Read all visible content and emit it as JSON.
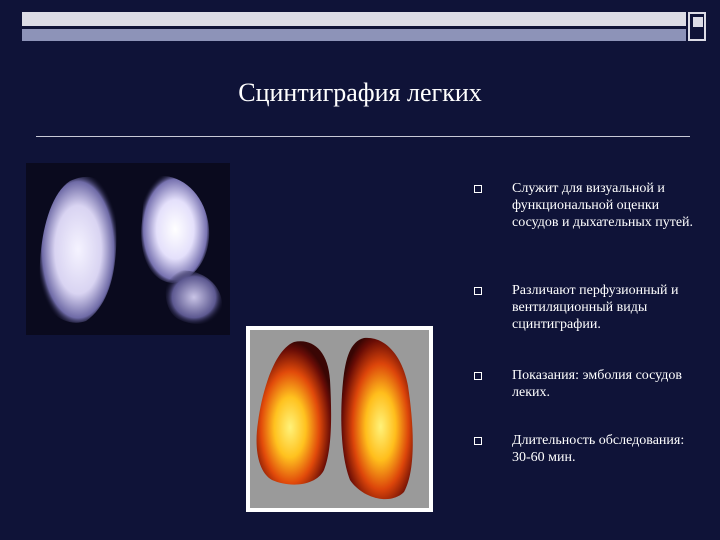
{
  "title": "Сцинтиграфия легких",
  "bullets": [
    {
      "text": "Служит для визуальной и функциональной оценки сосудов и дыхательных путей."
    },
    {
      "text": "Различают перфузионный и вентиляционный виды сцинтиграфии."
    },
    {
      "text": "Показания: эмболия сосудов леких."
    },
    {
      "text": "Длительность обследования: 30-60 мин."
    }
  ],
  "colors": {
    "background": "#0f1338",
    "text": "#ffffff",
    "bar_light": "#dcdce6",
    "bar_dark": "#8d93b8"
  }
}
